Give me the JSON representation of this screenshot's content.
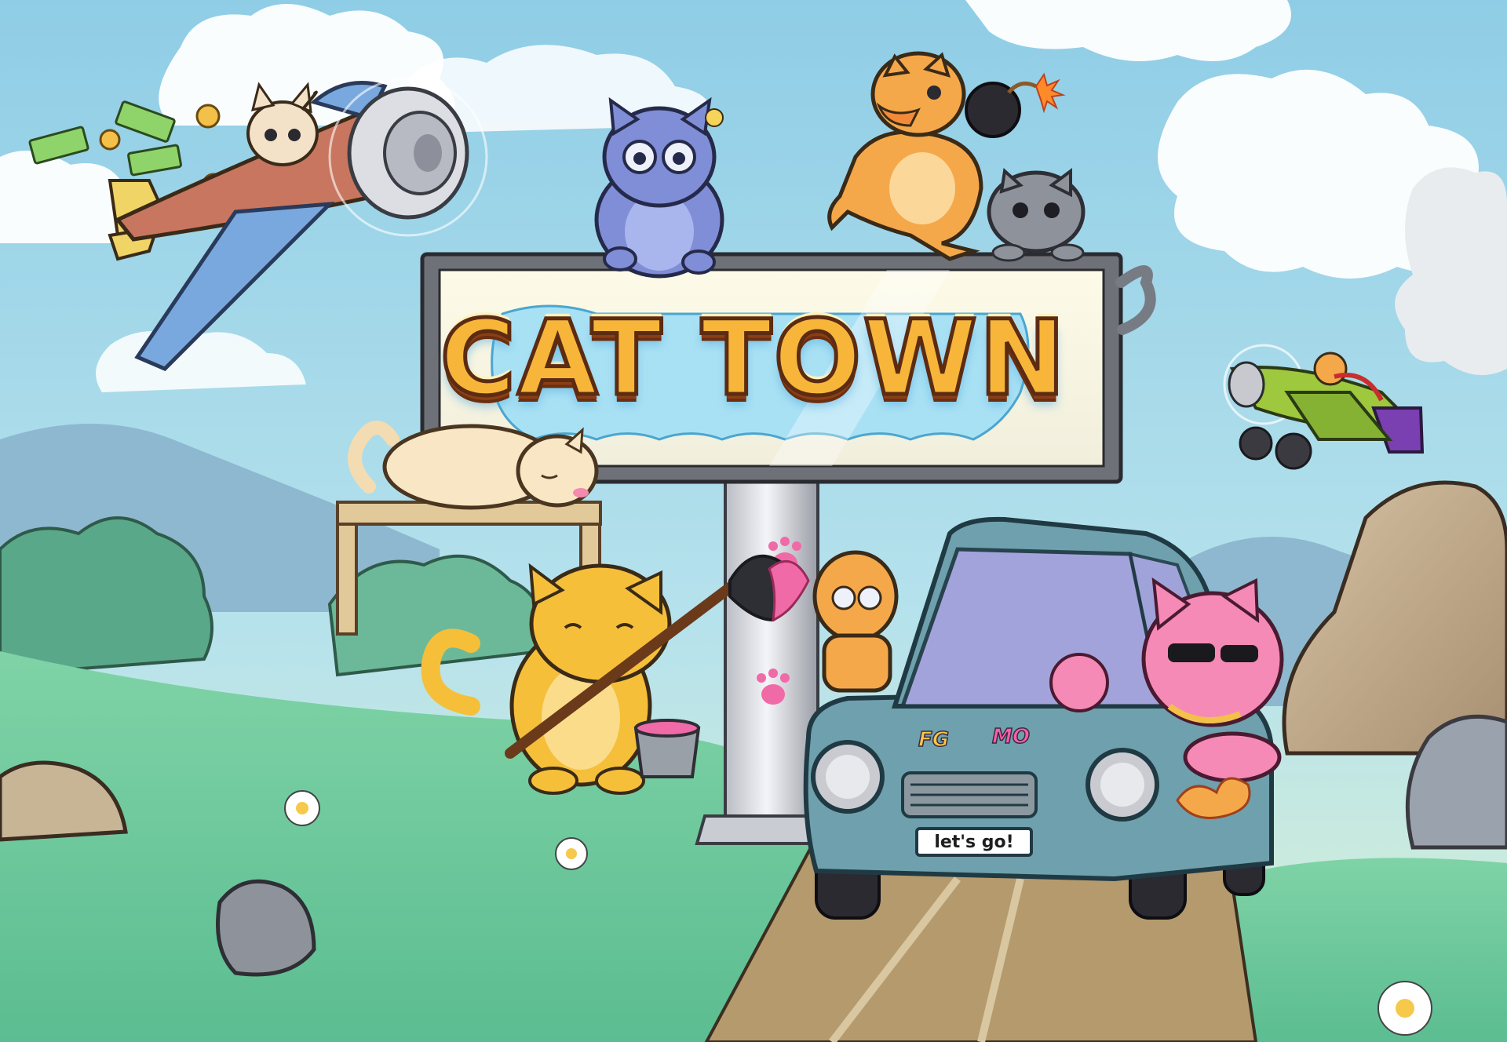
{
  "scene": {
    "title": "CAT TOWN",
    "license_plate": "let's go!",
    "car_decals": [
      "FG",
      "MO"
    ]
  },
  "colors": {
    "sky": "#9fd4ea",
    "grass": "#6cc79a",
    "road": "#b59a6c",
    "sign_text": "#f7b63a",
    "sign_outline": "#5c2b12",
    "car_body": "#6fa0ad",
    "pink_cat": "#f58ab6",
    "orange_cat": "#f5a84a",
    "blue_cat": "#7f8ed6"
  },
  "characters": [
    {
      "name": "pilot-cat-plane",
      "icon": "airplane-icon"
    },
    {
      "name": "pilot-cat-small-plane",
      "icon": "airplane-icon"
    },
    {
      "name": "blue-cat-with-glasses",
      "icon": "cat-icon"
    },
    {
      "name": "orange-cat-with-bomb",
      "icon": "bomb-icon"
    },
    {
      "name": "grey-cat-peeking",
      "icon": "cat-icon"
    },
    {
      "name": "sleeping-cat",
      "icon": "cat-icon"
    },
    {
      "name": "painter-cat",
      "icon": "paintbrush-icon"
    },
    {
      "name": "curly-cat-behind-pole",
      "icon": "cat-icon"
    },
    {
      "name": "pink-cat-driver",
      "icon": "sunglasses-icon"
    }
  ]
}
